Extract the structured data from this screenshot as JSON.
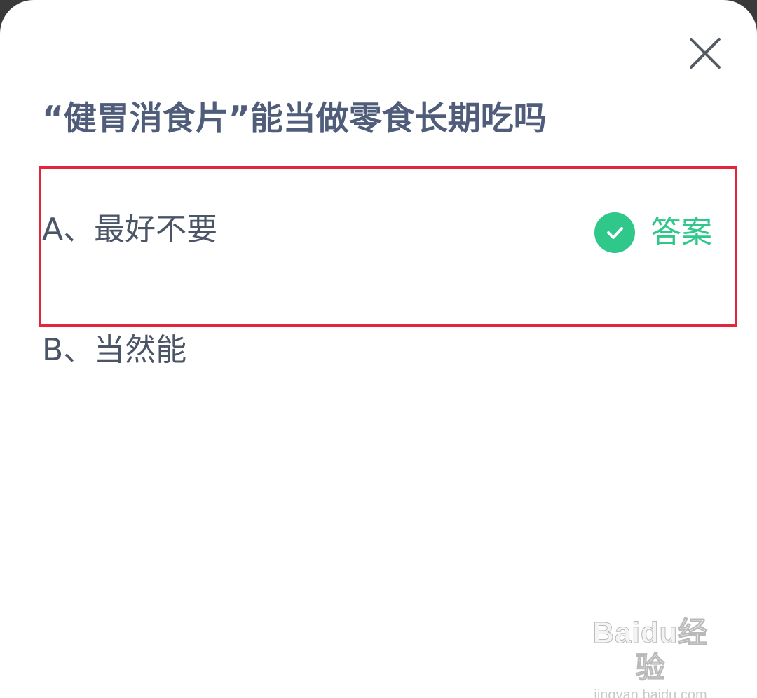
{
  "dialog": {
    "close_icon": "close-icon",
    "question": "“健胃消食片”能当做零食长期吃吗",
    "options": [
      {
        "label": "A、最好不要",
        "correct": true
      },
      {
        "label": "B、当然能",
        "correct": false
      }
    ],
    "answer_tag": {
      "icon": "check-circle-icon",
      "label": "答案"
    },
    "colors": {
      "question_text": "#4f5d7a",
      "option_text": "#4b5568",
      "answer_green": "#2fc78a",
      "highlight_red": "#e3263e"
    }
  },
  "watermark": {
    "logo": "Baidu经验",
    "url": "jingyan.baidu.com"
  }
}
